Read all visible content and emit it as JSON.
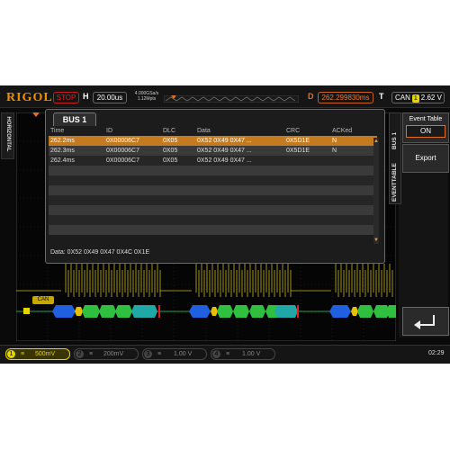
{
  "header": {
    "brand": "RIGOL",
    "run_state": "STOP",
    "h_label": "H",
    "h_value": "20.00us",
    "sample_rate_line1": "4.000GSa/s",
    "sample_rate_line2": "1.12Mpts",
    "delay_label": "D",
    "delay_value": "262.299830ms",
    "trigger_label": "T",
    "trigger_source": "CAN",
    "trigger_channel": "1",
    "trigger_level": "2.62 V"
  },
  "left_tab": {
    "label": "HORIZONTAL"
  },
  "bus_panel": {
    "title": "BUS 1",
    "columns": [
      "Time",
      "ID",
      "DLC",
      "Data",
      "CRC",
      "ACKed"
    ],
    "rows": [
      {
        "time": "262.2ms",
        "id": "0X00006C7",
        "dlc": "0X05",
        "data": "0X52 0X49 0X47 ...",
        "crc": "0X5D1E",
        "acked": "N"
      },
      {
        "time": "262.3ms",
        "id": "0X00006C7",
        "dlc": "0X05",
        "data": "0X52 0X49 0X47 ...",
        "crc": "0X5D1E",
        "acked": "N"
      },
      {
        "time": "262.4ms",
        "id": "0X00006C7",
        "dlc": "0X05",
        "data": "0X52 0X49 0X47 ...",
        "crc": "",
        "acked": ""
      }
    ],
    "selected_row": 0,
    "data_line": "Data: 0X52 0X49 0X47 0X4C 0X1E"
  },
  "side_tabs": {
    "bus": "BUS 1",
    "event_table": "EVENTTABLE"
  },
  "menu": {
    "event_table_label": "Event Table",
    "event_table_state": "ON",
    "export_label": "Export"
  },
  "waveform": {
    "can_label": "CAN",
    "trace_color": "#c8b820",
    "accent": "#e07020"
  },
  "channels": [
    {
      "num": "1",
      "value": "500mV",
      "active": true,
      "color": "#e6d400"
    },
    {
      "num": "2",
      "value": "200mV",
      "active": false,
      "color": "#555555"
    },
    {
      "num": "3",
      "value": "1.00 V",
      "active": false,
      "color": "#555555"
    },
    {
      "num": "4",
      "value": "1.00 V",
      "active": false,
      "color": "#555555"
    }
  ],
  "clock": "02:29"
}
